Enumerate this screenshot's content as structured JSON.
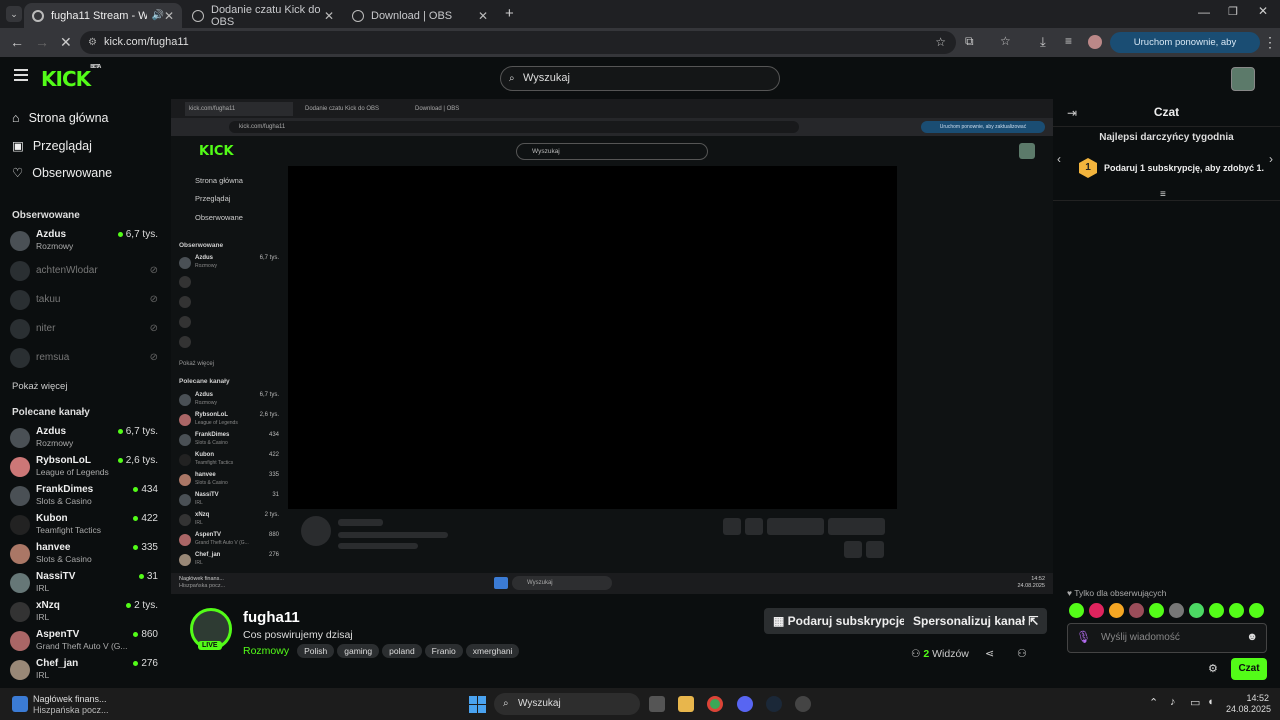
{
  "browser": {
    "tabs": [
      {
        "label": "fugha11 Stream - Watch Li..."
      },
      {
        "label": "Dodanie czatu Kick do OBS"
      },
      {
        "label": "Download | OBS"
      }
    ],
    "url": "kick.com/fugha11",
    "relaunch_label": "Uruchom ponownie, aby zaktualizować"
  },
  "kick": {
    "logo": "KICK",
    "logo_badge": "BETA",
    "search_placeholder": "Wyszukaj"
  },
  "sidebar": {
    "nav": [
      {
        "label": "Strona główna",
        "icon": "home-icon"
      },
      {
        "label": "Przeglądaj",
        "icon": "browse-icon"
      },
      {
        "label": "Obserwowane",
        "icon": "heart-icon"
      }
    ],
    "followed_heading": "Obserwowane",
    "followed": [
      {
        "name": "Azdus",
        "category": "Rozmowy",
        "viewers": "6,7 tys.",
        "live": true
      },
      {
        "name": "achtenWlodar",
        "category": "",
        "viewers": "",
        "live": false
      },
      {
        "name": "takuu",
        "category": "",
        "viewers": "",
        "live": false
      },
      {
        "name": "niter",
        "category": "",
        "viewers": "",
        "live": false
      },
      {
        "name": "remsua",
        "category": "",
        "viewers": "",
        "live": false
      }
    ],
    "show_more": "Pokaż więcej",
    "recommended_heading": "Polecane kanały",
    "recommended": [
      {
        "name": "Azdus",
        "category": "Rozmowy",
        "viewers": "6,7 tys."
      },
      {
        "name": "RybsonLoL",
        "category": "League of Legends",
        "viewers": "2,6 tys."
      },
      {
        "name": "FrankDimes",
        "category": "Slots & Casino",
        "viewers": "434"
      },
      {
        "name": "Kubon",
        "category": "Teamfight Tactics",
        "viewers": "422"
      },
      {
        "name": "hanvee",
        "category": "Slots & Casino",
        "viewers": "335"
      },
      {
        "name": "NassiTV",
        "category": "IRL",
        "viewers": "31"
      },
      {
        "name": "xNzq",
        "category": "IRL",
        "viewers": "2 tys."
      },
      {
        "name": "AspenTV",
        "category": "Grand Theft Auto V (G...",
        "viewers": "860"
      },
      {
        "name": "Chef_jan",
        "category": "IRL",
        "viewers": "276"
      }
    ]
  },
  "nested": {
    "tabs": [
      "kick.com/fugha11",
      "Dodanie czatu Kick do OBS",
      "Download | OBS"
    ],
    "url": "kick.com/fugha11",
    "relaunch": "Uruchom ponownie, aby zaktualizować",
    "search": "Wyszukaj",
    "nav": [
      "Strona główna",
      "Przeglądaj",
      "Obserwowane"
    ],
    "followed_heading": "Obserwowane",
    "followed_live": {
      "name": "Azdus",
      "category": "Rozmowy",
      "viewers": "6,7 tys."
    },
    "show_more": "Pokaż więcej",
    "recommended_heading": "Polecane kanały",
    "recommended": [
      {
        "name": "Azdus",
        "category": "Rozmowy",
        "viewers": "6,7 tys."
      },
      {
        "name": "RybsonLoL",
        "category": "League of Legends",
        "viewers": "2,6 tys."
      },
      {
        "name": "FrankDimes",
        "category": "Slots & Casino",
        "viewers": "434"
      },
      {
        "name": "Kubon",
        "category": "Teamfight Tactics",
        "viewers": "422"
      },
      {
        "name": "hanvee",
        "category": "Slots & Casino",
        "viewers": "335"
      },
      {
        "name": "NassiTV",
        "category": "IRL",
        "viewers": "31"
      },
      {
        "name": "xNzq",
        "category": "IRL",
        "viewers": "2 tys."
      },
      {
        "name": "AspenTV",
        "category": "Grand Theft Auto V (G...",
        "viewers": "880"
      },
      {
        "name": "Chef_jan",
        "category": "IRL",
        "viewers": "276"
      }
    ],
    "taskbar": {
      "news_title": "Nagłówek finans...",
      "news_sub": "Hiszpańska pocz...",
      "search": "Wyszukaj",
      "time": "14:52",
      "date": "24.08.2025"
    }
  },
  "channel": {
    "name": "fugha11",
    "title": "Cos poswirujemy dzisaj",
    "live_badge": "LIVE",
    "category": "Rozmowy",
    "tags": [
      "Polish",
      "gaming",
      "poland",
      "Franio",
      "xmerghani"
    ],
    "sub_button": "Podaruj subskrypcje",
    "customize_button": "Spersonalizuj kanał",
    "viewers_count": "2",
    "viewers_label": "Widzów"
  },
  "chat": {
    "title": "Czat",
    "leaderboard_title": "Najlepsi darczyńcy tygodnia",
    "leaderboard_rank": "1",
    "leaderboard_text": "Podaruj 1 subskrypcję, aby zdobyć 1.",
    "followers_only": "Tylko dla obserwujących",
    "input_placeholder": "Wyślij wiadomość",
    "send_button": "Czat",
    "emote_colors": [
      "#53fc18",
      "#e0245e",
      "#f5a623",
      "#9b4d5a",
      "#53fc18",
      "#777777",
      "#4cd964",
      "#53fc18",
      "#53fc18",
      "#53fc18"
    ]
  },
  "taskbar": {
    "news_title": "Nagłówek finans...",
    "news_sub": "Hiszpańska pocz...",
    "search": "Wyszukaj",
    "time": "14:52",
    "date": "24.08.2025"
  }
}
